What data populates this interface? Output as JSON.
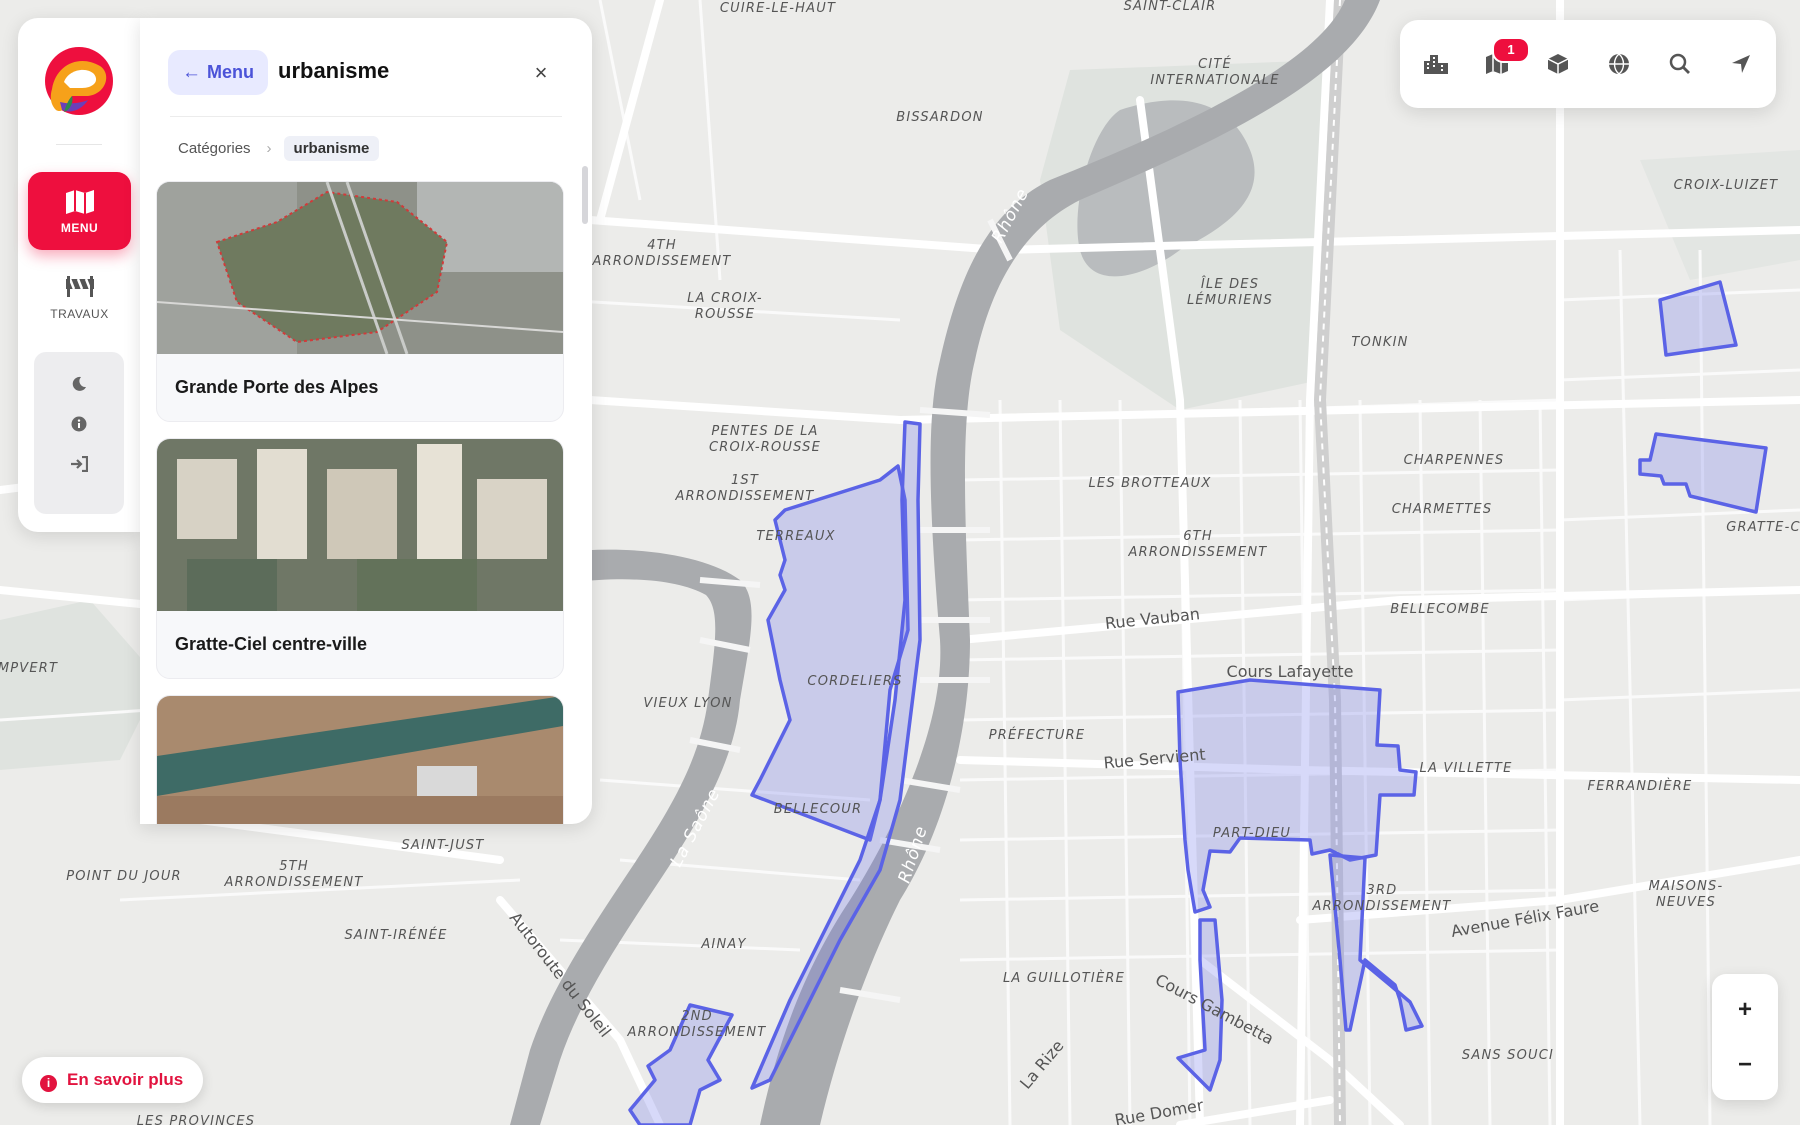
{
  "rail": {
    "menu_label": "MENU",
    "travaux_label": "TRAVAUX",
    "tools": [
      "moon-icon",
      "info-icon",
      "login-icon"
    ]
  },
  "panel": {
    "back_label": "Menu",
    "title": "urbanisme",
    "breadcrumb": [
      "Catégories",
      "urbanisme"
    ],
    "cards": [
      {
        "title": "Grande Porte des Alpes"
      },
      {
        "title": "Gratte-Ciel centre-ville"
      },
      {
        "title": ""
      }
    ]
  },
  "toolbar": {
    "icons": [
      "buildings-icon",
      "map-layers-icon",
      "cube-3d-icon",
      "globe-icon",
      "search-icon",
      "locate-arrow-icon"
    ],
    "badge": "1"
  },
  "zoom": {
    "in": "+",
    "out": "−"
  },
  "info_button": {
    "label": "En savoir plus"
  },
  "map": {
    "labels": {
      "cuire": "CUIRE-LE-HAUT",
      "saint_clair": "SAINT-CLAIR",
      "cite_1": "CITÉ",
      "cite_2": "INTERNATIONALE",
      "bissardon": "BISSARDON",
      "croix_luizet": "CROIX-LUIZET",
      "ardt4_1": "4TH",
      "ardt4_2": "ARRONDISSEMENT",
      "croix_rousse_1": "LA CROIX-",
      "croix_rousse_2": "ROUSSE",
      "ile_1": "ÎLE DES",
      "ile_2": "LÉMURIENS",
      "tonkin": "TONKIN",
      "pentes_1": "PENTES DE LA",
      "pentes_2": "CROIX-ROUSSE",
      "ardt1_1": "1ST",
      "ardt1_2": "ARRONDISSEMENT",
      "brotteaux": "LES BROTTEAUX",
      "charpennes": "CHARPENNES",
      "charmettes": "CHARMETTES",
      "terreaux": "TERREAUX",
      "ardt6_1": "6TH",
      "ardt6_2": "ARRONDISSEMENT",
      "gratte_ci": "GRATTE-CI",
      "bellecombe": "BELLECOMBE",
      "cordeliers": "CORDELIERS",
      "vieux_lyon": "VIEUX LYON",
      "prefecture": "PRÉFECTURE",
      "la_villette": "LA VILLETTE",
      "ferrandiere": "FERRANDIÈRE",
      "mpvert": "MPVERT",
      "bellecour": "BELLECOUR",
      "part_dieu": "PART-DIEU",
      "saint_just": "SAINT-JUST",
      "point_du_jour": "POINT DU JOUR",
      "ardt5_1": "5TH",
      "ardt5_2": "ARRONDISSEMENT",
      "ardt3_1": "3RD",
      "ardt3_2": "ARRONDISSEMENT",
      "maisons_1": "MAISONS-",
      "maisons_2": "NEUVES",
      "saint_irenee": "SAINT-IRÉNÉE",
      "ainay": "AINAY",
      "guillotiere": "LA GUILLOTIÈRE",
      "ardt2_1": "2ND",
      "ardt2_2": "ARRONDISSEMENT",
      "sans_souci": "SANS SOUCI",
      "provinces": "LES PROVINCES"
    },
    "streets": {
      "vauban": "Rue Vauban",
      "lafayette": "Cours Lafayette",
      "servient": "Rue Servient",
      "felix_faure": "Avenue Félix Faure",
      "gambetta": "Cours Gambetta",
      "autoroute": "Autoroute du Soleil",
      "rize": "La Rize",
      "domer": "Rue Domer"
    },
    "rivers": {
      "rhone": "Rhône",
      "saone": "La Saône"
    },
    "colors": {
      "zone_fill": "#6e78eb",
      "zone_stroke": "#5b63e6",
      "accent": "#ee0f3e",
      "river": "#a7a9ac"
    }
  }
}
